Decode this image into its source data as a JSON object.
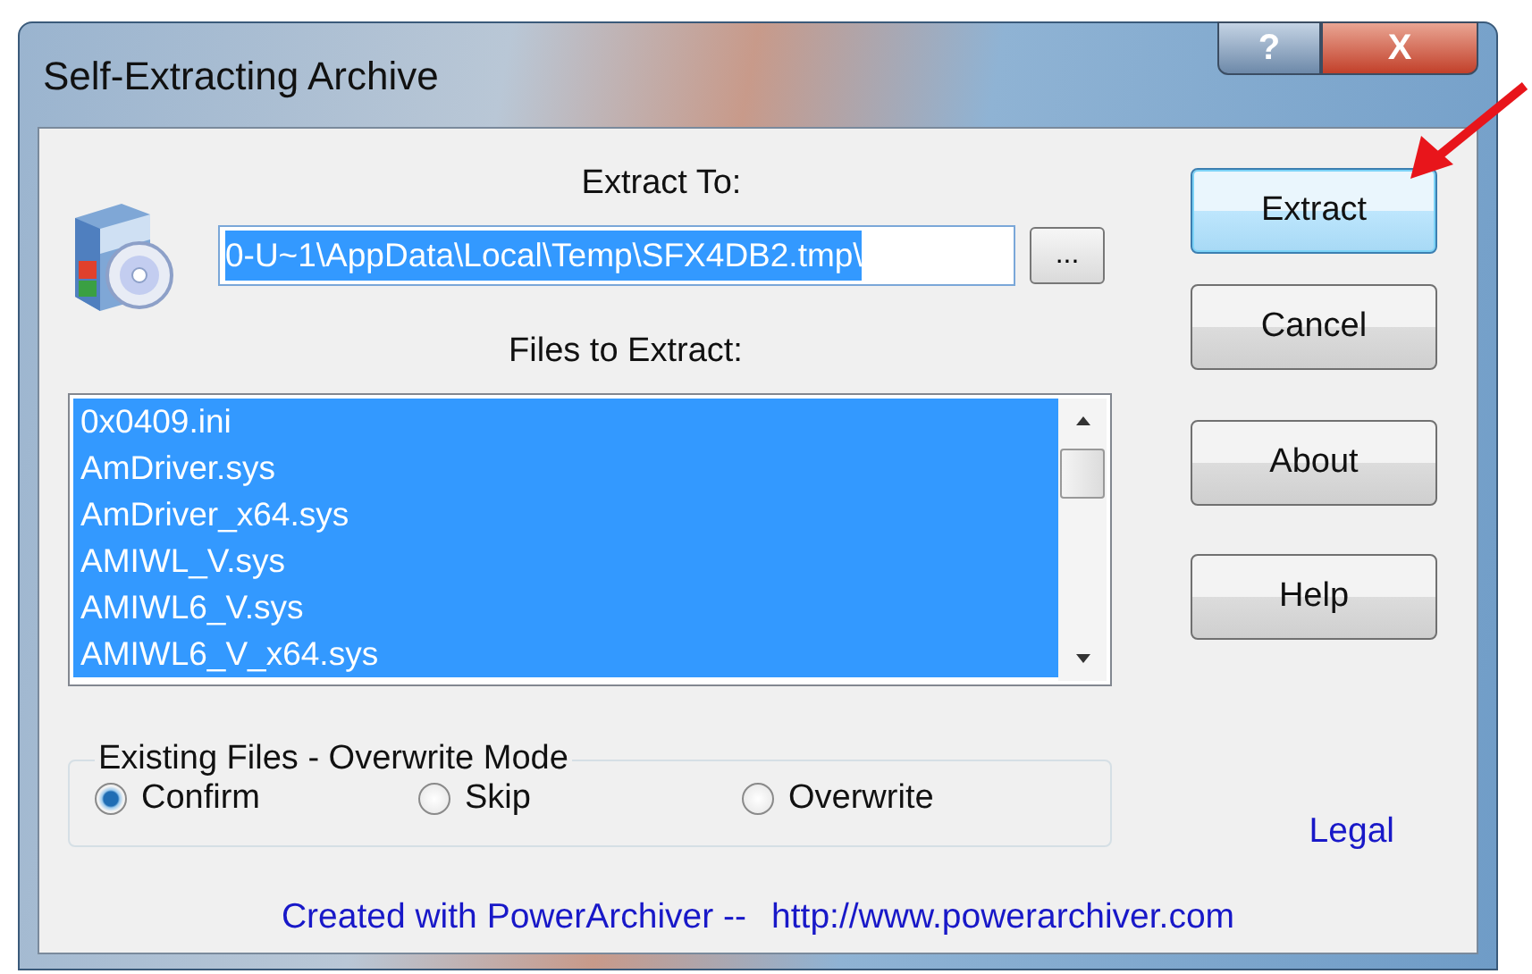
{
  "window": {
    "title": "Self-Extracting Archive",
    "title_buttons": [
      "?",
      "X"
    ]
  },
  "extract_to": {
    "label": "Extract To:",
    "value": "0-U~1\\AppData\\Local\\Temp\\SFX4DB2.tmp\\",
    "browse": "..."
  },
  "files": {
    "label": "Files to Extract:",
    "items": [
      {
        "name": "0x0409.ini",
        "selected": true
      },
      {
        "name": "AmDriver.sys",
        "selected": true
      },
      {
        "name": "AmDriver_x64.sys",
        "selected": true
      },
      {
        "name": "AMIWL_V.sys",
        "selected": true
      },
      {
        "name": "AMIWL6_V.sys",
        "selected": true
      },
      {
        "name": "AMIWL6_V_x64.sys",
        "selected": true
      }
    ]
  },
  "overwrite_mode": {
    "label": "Existing Files - Overwrite Mode",
    "options": [
      {
        "label": "Confirm",
        "selected": true
      },
      {
        "label": "Skip",
        "selected": false
      },
      {
        "label": "Overwrite",
        "selected": false
      }
    ]
  },
  "buttons": [
    {
      "label": "Extract",
      "focused": true
    },
    {
      "label": "Cancel",
      "focused": false
    },
    {
      "label": "About",
      "focused": false
    },
    {
      "label": "Help",
      "focused": false
    }
  ],
  "legal_link": "Legal",
  "footer": {
    "text": "Created with PowerArchiver  --",
    "link": "http://www.powerarchiver.com"
  }
}
